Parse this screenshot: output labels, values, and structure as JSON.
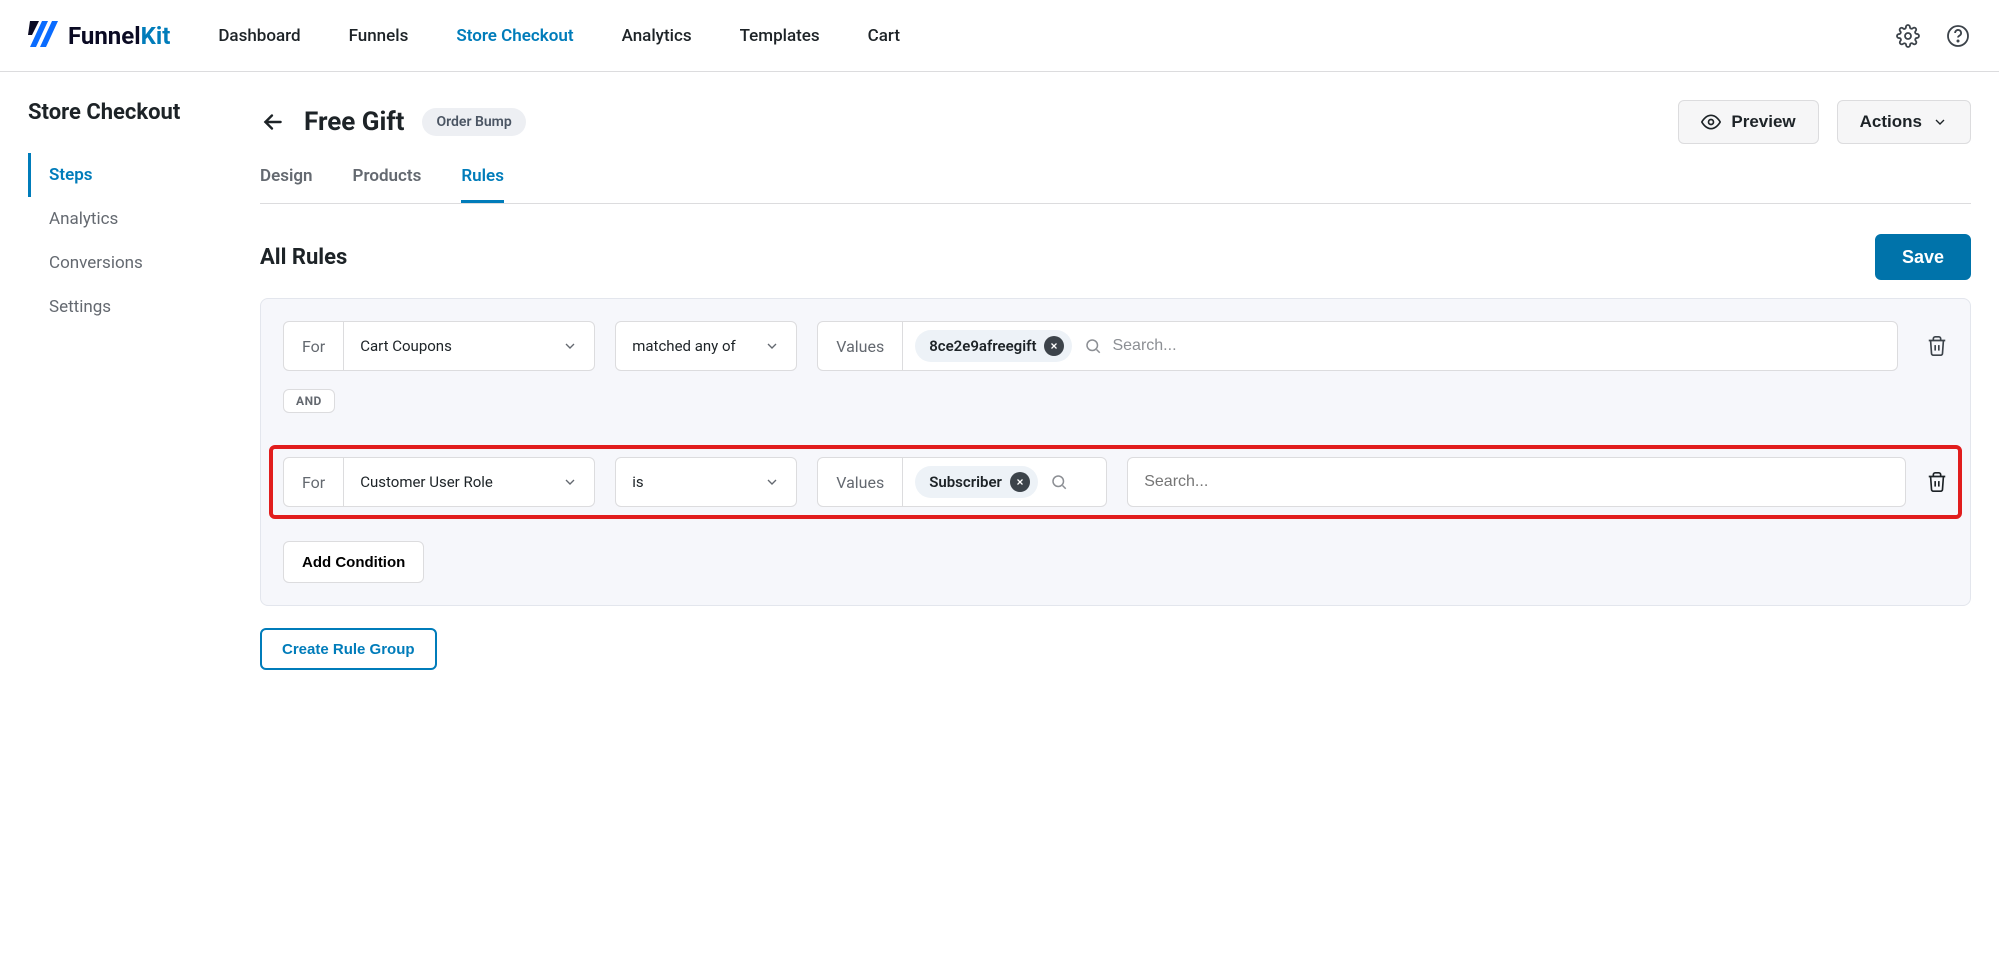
{
  "brand": {
    "name": "Funnel",
    "suffix": "Kit"
  },
  "nav": {
    "items": [
      {
        "label": "Dashboard"
      },
      {
        "label": "Funnels"
      },
      {
        "label": "Store Checkout",
        "active": true
      },
      {
        "label": "Analytics"
      },
      {
        "label": "Templates"
      },
      {
        "label": "Cart"
      }
    ]
  },
  "sidebar": {
    "title": "Store Checkout",
    "items": [
      {
        "label": "Steps",
        "active": true
      },
      {
        "label": "Analytics"
      },
      {
        "label": "Conversions"
      },
      {
        "label": "Settings"
      }
    ]
  },
  "page": {
    "title": "Free Gift",
    "badge": "Order Bump",
    "preview_label": "Preview",
    "actions_label": "Actions"
  },
  "subtabs": [
    {
      "label": "Design"
    },
    {
      "label": "Products"
    },
    {
      "label": "Rules",
      "active": true
    }
  ],
  "rules": {
    "section_title": "All Rules",
    "save_label": "Save",
    "for_label": "For",
    "values_label": "Values",
    "search_placeholder": "Search...",
    "and_label": "AND",
    "add_condition_label": "Add Condition",
    "create_group_label": "Create Rule Group",
    "rows": [
      {
        "field": "Cart Coupons",
        "operator": "matched any of",
        "chips": [
          "8ce2e9afreegift"
        ]
      },
      {
        "field": "Customer User Role",
        "operator": "is",
        "chips": [
          "Subscriber"
        ],
        "highlighted": true
      }
    ]
  }
}
